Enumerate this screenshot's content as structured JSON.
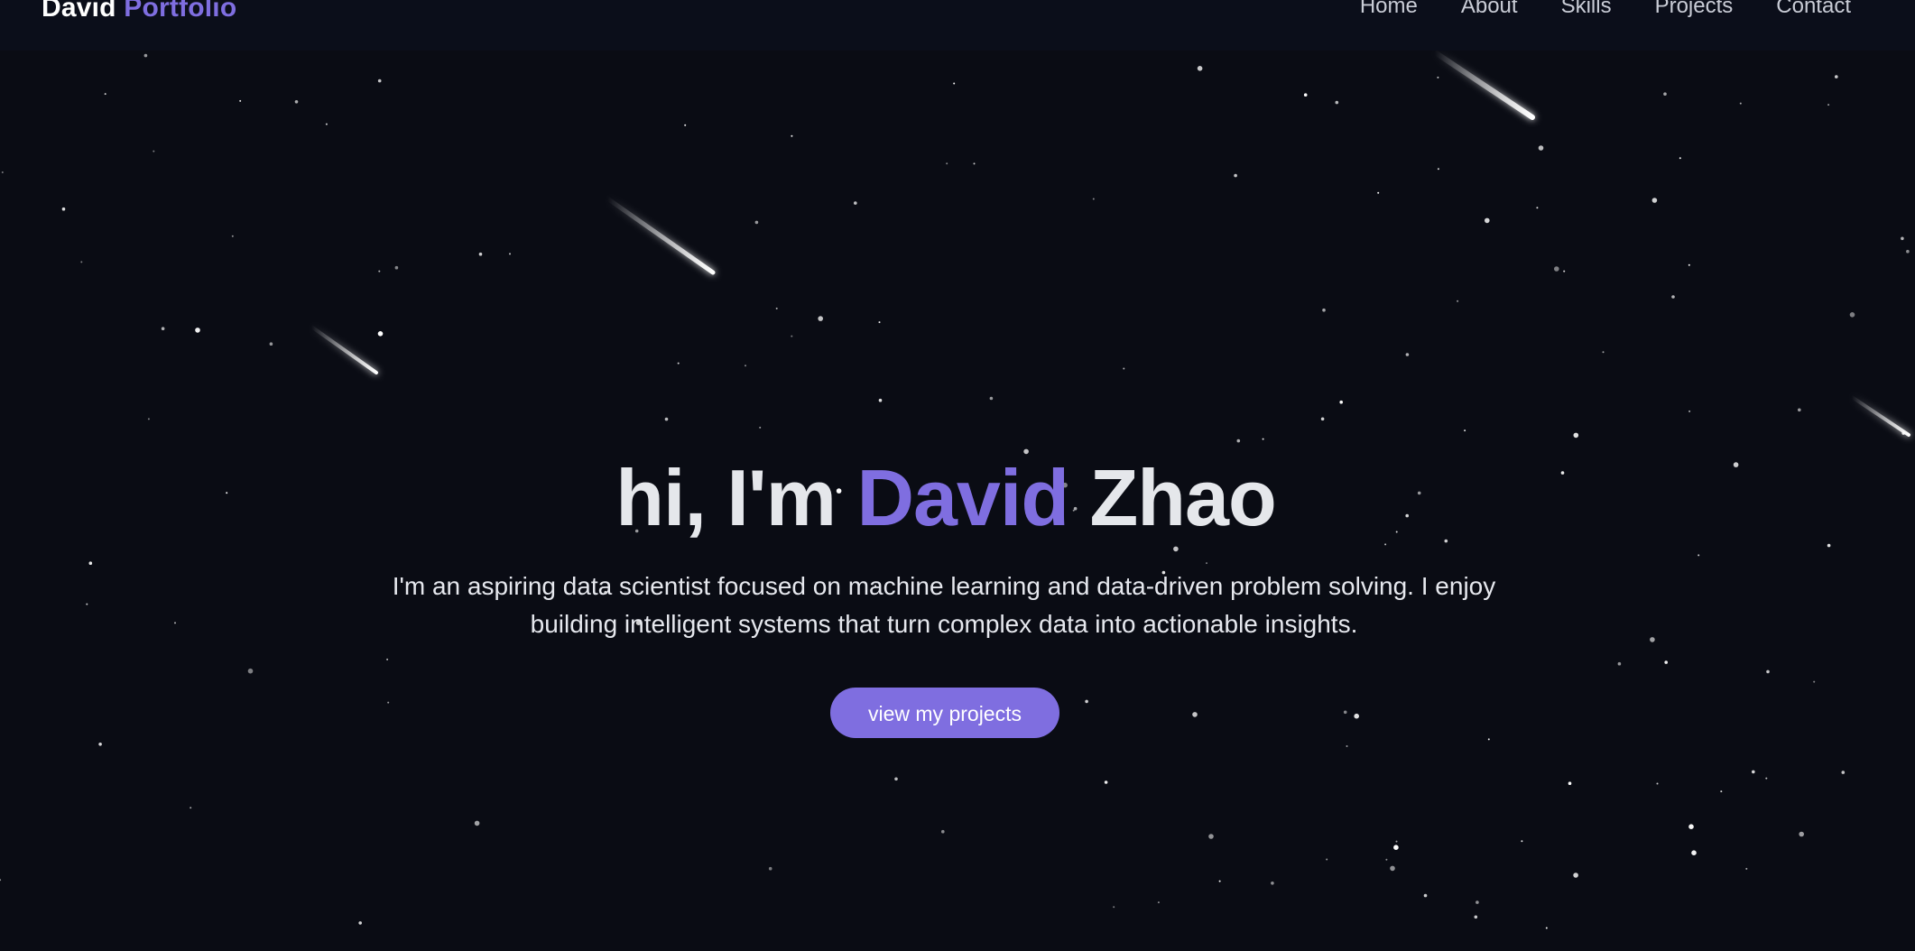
{
  "navbar": {
    "brand_first": "David",
    "brand_second": "Portfolio",
    "links": [
      "Home",
      "About",
      "Skills",
      "Projects",
      "Contact"
    ]
  },
  "hero": {
    "title_prefix": "hi, I'm",
    "title_highlight": "David",
    "title_suffix": "Zhao",
    "subtitle": "I'm an aspiring data scientist focused on machine learning and data-driven problem solving. I enjoy building intelligent systems that turn complex data into actionable insights.",
    "cta_label": "view my projects"
  },
  "colors": {
    "background": "#0a0c14",
    "navbar": "#0b0e1a",
    "accent": "#7f6ee0",
    "text": "#e5e7eb"
  }
}
